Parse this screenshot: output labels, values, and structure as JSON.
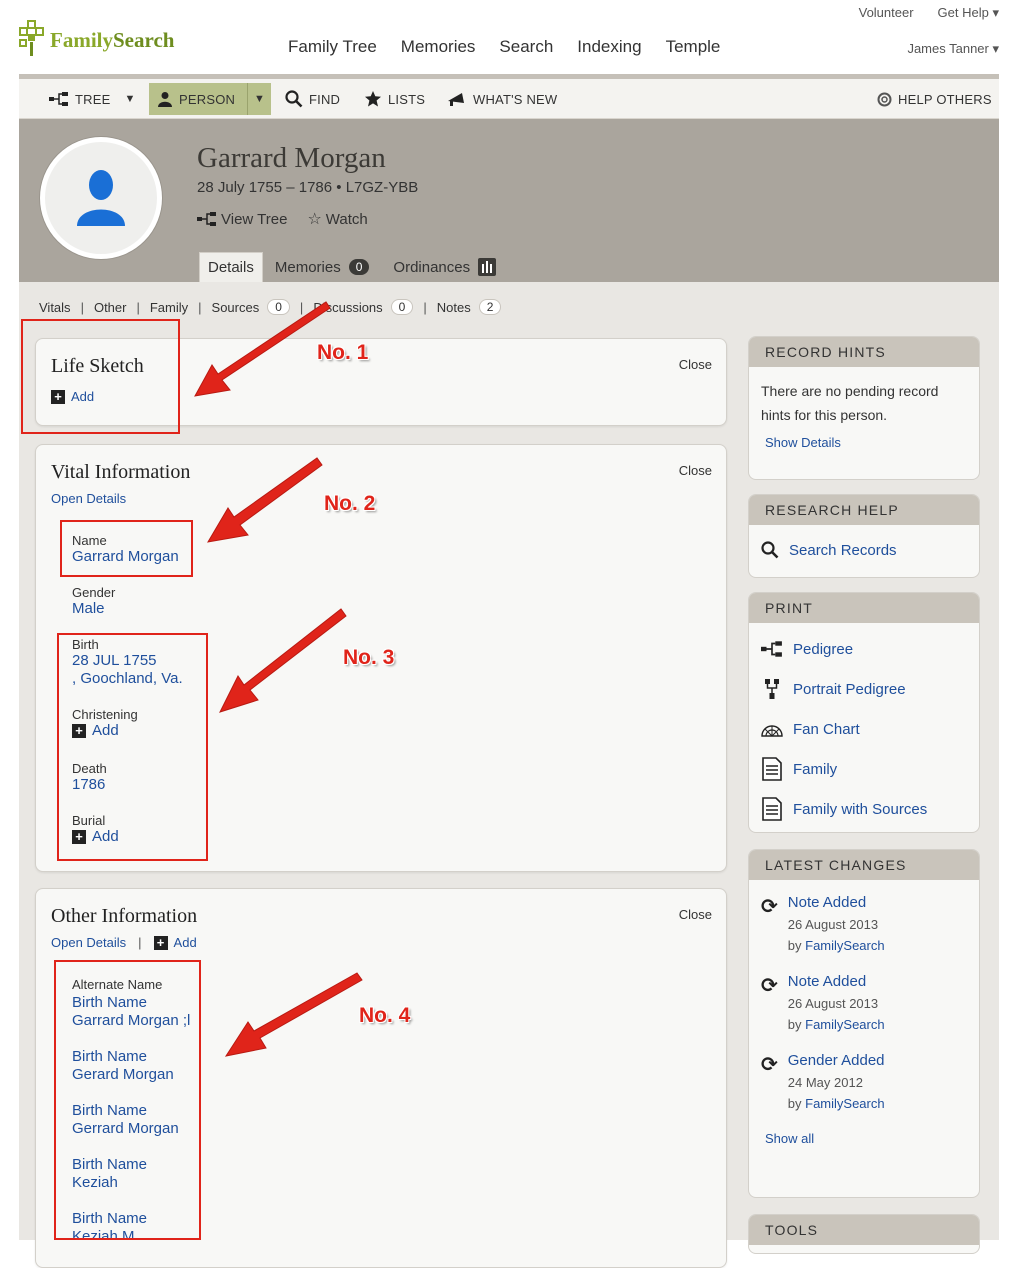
{
  "header": {
    "brand_family": "Family",
    "brand_search": "Search",
    "util_links": [
      "Volunteer",
      "Get Help ▾"
    ],
    "nav": [
      "Family Tree",
      "Memories",
      "Search",
      "Indexing",
      "Temple"
    ],
    "user": "James Tanner ▾"
  },
  "toolbar": {
    "tree": "TREE",
    "person": "PERSON",
    "find": "FIND",
    "lists": "LISTS",
    "whats_new": "WHAT'S NEW",
    "help_others": "HELP OTHERS"
  },
  "person": {
    "name": "Garrard Morgan",
    "dates_id": "28 July 1755 – 1786 • L7GZ-YBB",
    "view_tree": "View Tree",
    "watch": "Watch"
  },
  "tabs": {
    "details": "Details",
    "memories": "Memories",
    "memories_count": "0",
    "ordinances": "Ordinances"
  },
  "subnav": {
    "vitals": "Vitals",
    "other": "Other",
    "family": "Family",
    "sources": "Sources",
    "sources_count": "0",
    "discussions": "Discussions",
    "discussions_count": "0",
    "notes": "Notes",
    "notes_count": "2",
    "sep": "|"
  },
  "life_sketch": {
    "title": "Life Sketch",
    "close": "Close",
    "add": "Add"
  },
  "vital": {
    "title": "Vital Information",
    "close": "Close",
    "open_details": "Open Details",
    "name_label": "Name",
    "name_value": "Garrard Morgan",
    "gender_label": "Gender",
    "gender_value": "Male",
    "birth_label": "Birth",
    "birth_date": "28 JUL 1755",
    "birth_place": ", Goochland, Va.",
    "christening_label": "Christening",
    "christening_add": "Add",
    "death_label": "Death",
    "death_value": "1786",
    "burial_label": "Burial",
    "burial_add": "Add"
  },
  "other": {
    "title": "Other Information",
    "close": "Close",
    "open_details": "Open Details",
    "sep": "|",
    "add": "Add",
    "alt_label": "Alternate Name",
    "names": [
      {
        "type": "Birth Name",
        "value": "Garrard Morgan ;l"
      },
      {
        "type": "Birth Name",
        "value": "Gerard Morgan"
      },
      {
        "type": "Birth Name",
        "value": "Gerrard Morgan"
      },
      {
        "type": "Birth Name",
        "value": "Keziah"
      },
      {
        "type": "Birth Name",
        "value": "Keziah M..."
      }
    ]
  },
  "record_hints": {
    "title": "RECORD HINTS",
    "text": "There are no pending record hints for this person.",
    "show_details": "Show Details"
  },
  "research_help": {
    "title": "RESEARCH HELP",
    "search_records": "Search Records"
  },
  "print": {
    "title": "PRINT",
    "items": [
      "Pedigree",
      "Portrait Pedigree",
      "Fan Chart",
      "Family",
      "Family with Sources"
    ]
  },
  "latest_changes": {
    "title": "LATEST CHANGES",
    "items": [
      {
        "title": "Note Added",
        "date": "26 August 2013",
        "by": "by",
        "who": "FamilySearch"
      },
      {
        "title": "Note Added",
        "date": "26 August 2013",
        "by": "by",
        "who": "FamilySearch"
      },
      {
        "title": "Gender Added",
        "date": "24 May 2012",
        "by": "by",
        "who": "FamilySearch"
      }
    ],
    "show_all": "Show all"
  },
  "tools": {
    "title": "TOOLS"
  },
  "annotations": {
    "no1": "No. 1",
    "no2": "No. 2",
    "no3": "No. 3",
    "no4": "No. 4",
    "color": "#e0241a"
  },
  "colors": {
    "banner": "#aaa59d",
    "content_bg": "#e9e7e3",
    "link": "#1f4f9c",
    "person_tab": "#b8c18b",
    "brand_green": "#8aa82a"
  }
}
